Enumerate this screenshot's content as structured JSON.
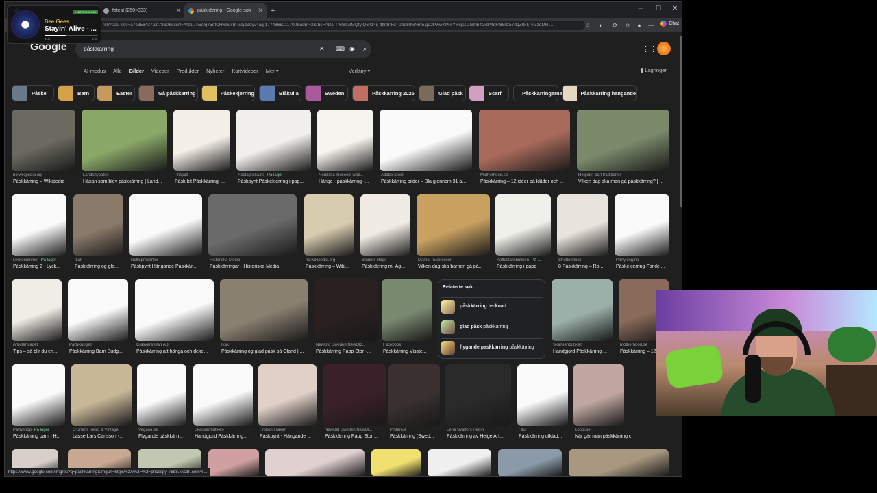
{
  "browser": {
    "tabs": [
      {
        "label": ""
      },
      {
        "label": "fatest (250×333)"
      },
      {
        "label": "påskkärring - Google-søk"
      }
    ],
    "new_tab": "+",
    "window_controls": {
      "minimize": "─",
      "maximize": "☐",
      "close": "✕"
    },
    "url": "rch?sca_esv=a7c356437a2f7860&sxsrf=ANbL-n5e/q75dfCHwbui.B-GdjdZdyv4ag:1774866211700&udm=2&fbs=ADc_l-YGrpJMQtyjQ6h14ij-dflrbPkd_Upq68wNmElgo2PwwKPNlYwsjssCGmh4GdP4oFf88rC57dqZ9xIjTyGzqMRl...",
    "chat_label": "Chat"
  },
  "search": {
    "logo": "Google",
    "query": "påskkärring",
    "tabs": [
      "AI-modus",
      "Alle",
      "Bilder",
      "Videoer",
      "Produkter",
      "Nyheter",
      "Kortvideoer",
      "Mer ▾"
    ],
    "selected_tab": "Bilder",
    "tools": "Verktøy ▾",
    "saves": "Lagringer"
  },
  "chips": [
    {
      "label": "Påske",
      "color": "#6a7a8a"
    },
    {
      "label": "Barn",
      "color": "#d4a04a"
    },
    {
      "label": "Easter",
      "color": "#c89a5a"
    },
    {
      "label": "Gå påskkärring",
      "color": "#8a6a5a"
    },
    {
      "label": "Påskekjerring",
      "color": "#e0c060"
    },
    {
      "label": "Blåkulla",
      "color": "#5a7ab0"
    },
    {
      "label": "Sweden",
      "color": "#a85a9a"
    },
    {
      "label": "Påskkärring 2025",
      "color": "#c07060"
    },
    {
      "label": "Glad påsk",
      "color": "#7a6a5a"
    },
    {
      "label": "Scarf",
      "color": "#d0a0c0"
    },
    {
      "label": "Påskkärringarna",
      "color": ""
    },
    {
      "label": "Påskkärring hängande",
      "color": "#e8d8c0"
    }
  ],
  "results": [
    {
      "src": "no.wikipedia.org",
      "title": "Påskkärring – Wikipedia",
      "color": "#6a6a60"
    },
    {
      "src": "Landshypotek",
      "title": "Häxan som blev påskkärring | Land...",
      "color": "#8aa868"
    },
    {
      "src": "Prisjakt",
      "title": "Påsk-kit Påskkärring -...",
      "color": "#f4f0e8"
    },
    {
      "src": "Nostalgiska.no",
      "stock": "· På lager",
      "title": "Påskpynt Påskekjerring i pap...",
      "color": "#f2f0ec"
    },
    {
      "src": "Nordiska museets web...",
      "title": "Hänge - påskkärring -...",
      "color": "#f6f4ee"
    },
    {
      "src": "Adobe Stock",
      "title": "Påskkärring bilder – Bla gjennom 31 a...",
      "color": "#fafafa"
    },
    {
      "src": "Motherhood.se",
      "title": "Påskkärring – 12 idéer på kläder och ...",
      "color": "#a86a5a"
    },
    {
      "src": "Högtider och traditioner",
      "title": "Vilken dag ska man gå påskkärring? | ...",
      "color": "#7a8a6a"
    },
    {
      "src": "Lyckonummet",
      "stock": "· På lager",
      "title": "Påskkärring 2 - Lyck...",
      "color": "#fafafa"
    },
    {
      "src": "Ikak",
      "title": "Påskkärring og gla...",
      "color": "#8a7a6a"
    },
    {
      "src": "Nellispresenter",
      "title": "Påskpynt Hängande Påskkär...",
      "color": "#fafafa"
    },
    {
      "src": "Historiska Media",
      "title": "Påskkärringar - Historiska Media",
      "color": "#6a6a6a"
    },
    {
      "src": "no.wikipedia.org",
      "title": "Påskkärring – Wiki...",
      "color": "#d8ccb0"
    },
    {
      "src": "Balders Hage",
      "title": "Påskkärring m. Äg...",
      "color": "#f0ece4"
    },
    {
      "src": "Mama - Expressen",
      "title": "Vilken dag ska barnen gå på...",
      "color": "#c8a060"
    },
    {
      "src": "Kaffestallsbutiken",
      "stock": "· På ...",
      "title": "Påskkärring i papp",
      "color": "#f0f0ea"
    },
    {
      "src": "Shutterstock",
      "title": "8 Påskkärring – Ro...",
      "color": "#e8e4dc"
    },
    {
      "src": "Partyking.no",
      "title": "Påskekjerring Forkle ...",
      "color": "#fafafa"
    },
    {
      "src": "Arbetarbladet",
      "title": "Tips – så blir du en...",
      "color": "#f0ece6"
    },
    {
      "src": "Partykungen",
      "title": "Påskkärring Barn Budg...",
      "color": "#fafafa"
    },
    {
      "src": "Glasverandan AB",
      "title": "Påskkärring att hänga och deko...",
      "color": "#fafafa"
    },
    {
      "src": "Ikak",
      "title": "Påskkärring og glad påsk på Öland | ...",
      "color": "#8a8070"
    },
    {
      "src": "NewOld Sweden NewOld...",
      "title": "Påskkärring Papp Stor -...",
      "color": "#2a2020"
    },
    {
      "src": "Facebook",
      "title": "Påskkärring Visste...",
      "color": "#7a8a70"
    },
    {
      "src": "Skansenbutiken",
      "title": "Handgjord Påskkärring ...",
      "color": "#9ab0a8"
    },
    {
      "src": "Motherhood.se",
      "title": "Påskkärring – 12",
      "color": "#8a6a5a"
    },
    {
      "src": "Partyshop",
      "stock": "· På lager",
      "title": "Påskkärring barn | H...",
      "color": "#fafafa"
    },
    {
      "src": "O'Briens Retro & Vintage",
      "title": "Lasse Lars Carlsson -...",
      "color": "#c8b898"
    },
    {
      "src": "Vegaoo.se",
      "title": "Flygande påskkärri...",
      "color": "#fafafa"
    },
    {
      "src": "Skansenbutiken",
      "title": "Handgjord Påskkärring...",
      "color": "#fafafa"
    },
    {
      "src": "Fröken Fräken",
      "title": "Påskpynt - Hängande ...",
      "color": "#e0d0c8"
    },
    {
      "src": "NewOld Sweden NewOl...",
      "title": "Påskkärring Papp Stor ...",
      "color": "#3a2028"
    },
    {
      "src": "Pinterest",
      "title": "Påskkärring (Swed...",
      "color": "#3a3030"
    },
    {
      "src": "Lena Svalfors Hedin",
      "title": "Påskkärring av Helge Art...",
      "color": "#2a2a2a"
    },
    {
      "src": "Filur",
      "title": "Påskkärring utklad...",
      "color": "#fafafa"
    },
    {
      "src": "Loppi.se",
      "title": "När går man påskkärring och när får m...",
      "color": "#c0a8a0"
    },
    {
      "src": "",
      "title": "",
      "color": "#d8d0c8"
    },
    {
      "src": "",
      "title": "",
      "color": "#c8a890"
    },
    {
      "src": "",
      "title": "",
      "color": "#c0c8b0"
    },
    {
      "src": "",
      "title": "",
      "color": "#d0a0a0"
    },
    {
      "src": "",
      "title": "",
      "color": "#e0d0d0"
    },
    {
      "src": "",
      "title": "",
      "color": "#f0e070"
    },
    {
      "src": "",
      "title": "",
      "color": "#f0f0f0"
    },
    {
      "src": "",
      "title": "",
      "color": "#8a9aa8"
    },
    {
      "src": "",
      "title": "",
      "color": "#a89880"
    }
  ],
  "related": {
    "heading": "Relaterte søk",
    "items": [
      {
        "bold": "påskkärring",
        "rest": " tecknad",
        "bold_first": false
      },
      {
        "bold": "glad påsk",
        "rest": " påskkärring",
        "bold_first": true
      },
      {
        "bold": "flygande paskkarring",
        "rest": " påskkärring",
        "bold_first": true
      }
    ]
  },
  "status_url": "https://www.google.com/imgres?q=påskkärring&imgurl=https%3A%2F%2Fpricespy-75b8.kxcdn.com%...",
  "now_playing": {
    "badge": "• NOW PLAYING",
    "artist": "Bee Gees",
    "song": "Stayin' Alive - ...",
    "elapsed": "3:03",
    "total": "4:45",
    "progress": 0.4
  },
  "colors": {
    "background": "#1f1f1f",
    "surface": "#303134",
    "text": "#e8eaed",
    "muted": "#9aa0a6",
    "accent": "#8ab4f8",
    "in_stock": "#81c995"
  }
}
